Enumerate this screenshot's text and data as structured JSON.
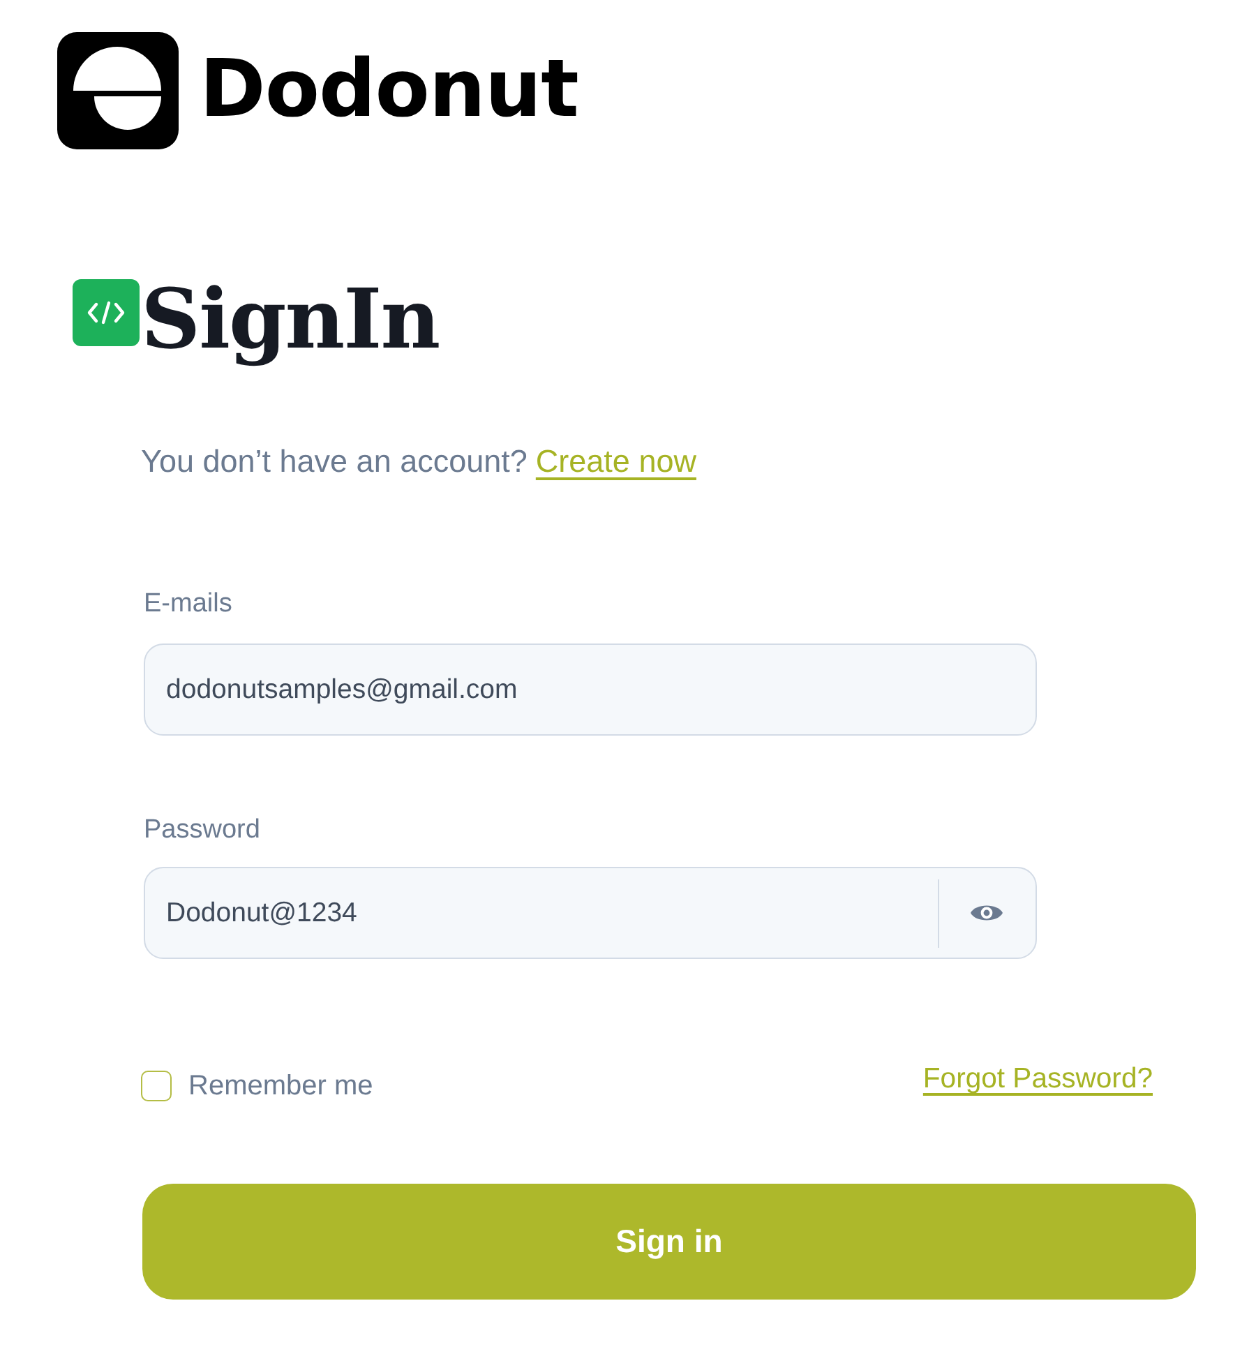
{
  "logo": {
    "name": "Dodonut"
  },
  "heading": {
    "title": "SignIn"
  },
  "signup_prompt": {
    "text": "You don’t have an account?",
    "link": "Create now"
  },
  "fields": [
    {
      "kind": "text",
      "label": "E-mails",
      "value": "dodonutsamples@gmail.com"
    },
    {
      "kind": "password",
      "label": "Password",
      "value": "Dodonut@1234"
    }
  ],
  "remember": {
    "label": "Remember me",
    "checked": false
  },
  "forgot_link": "Forgot Password?",
  "submit": {
    "label": "Sign in"
  }
}
